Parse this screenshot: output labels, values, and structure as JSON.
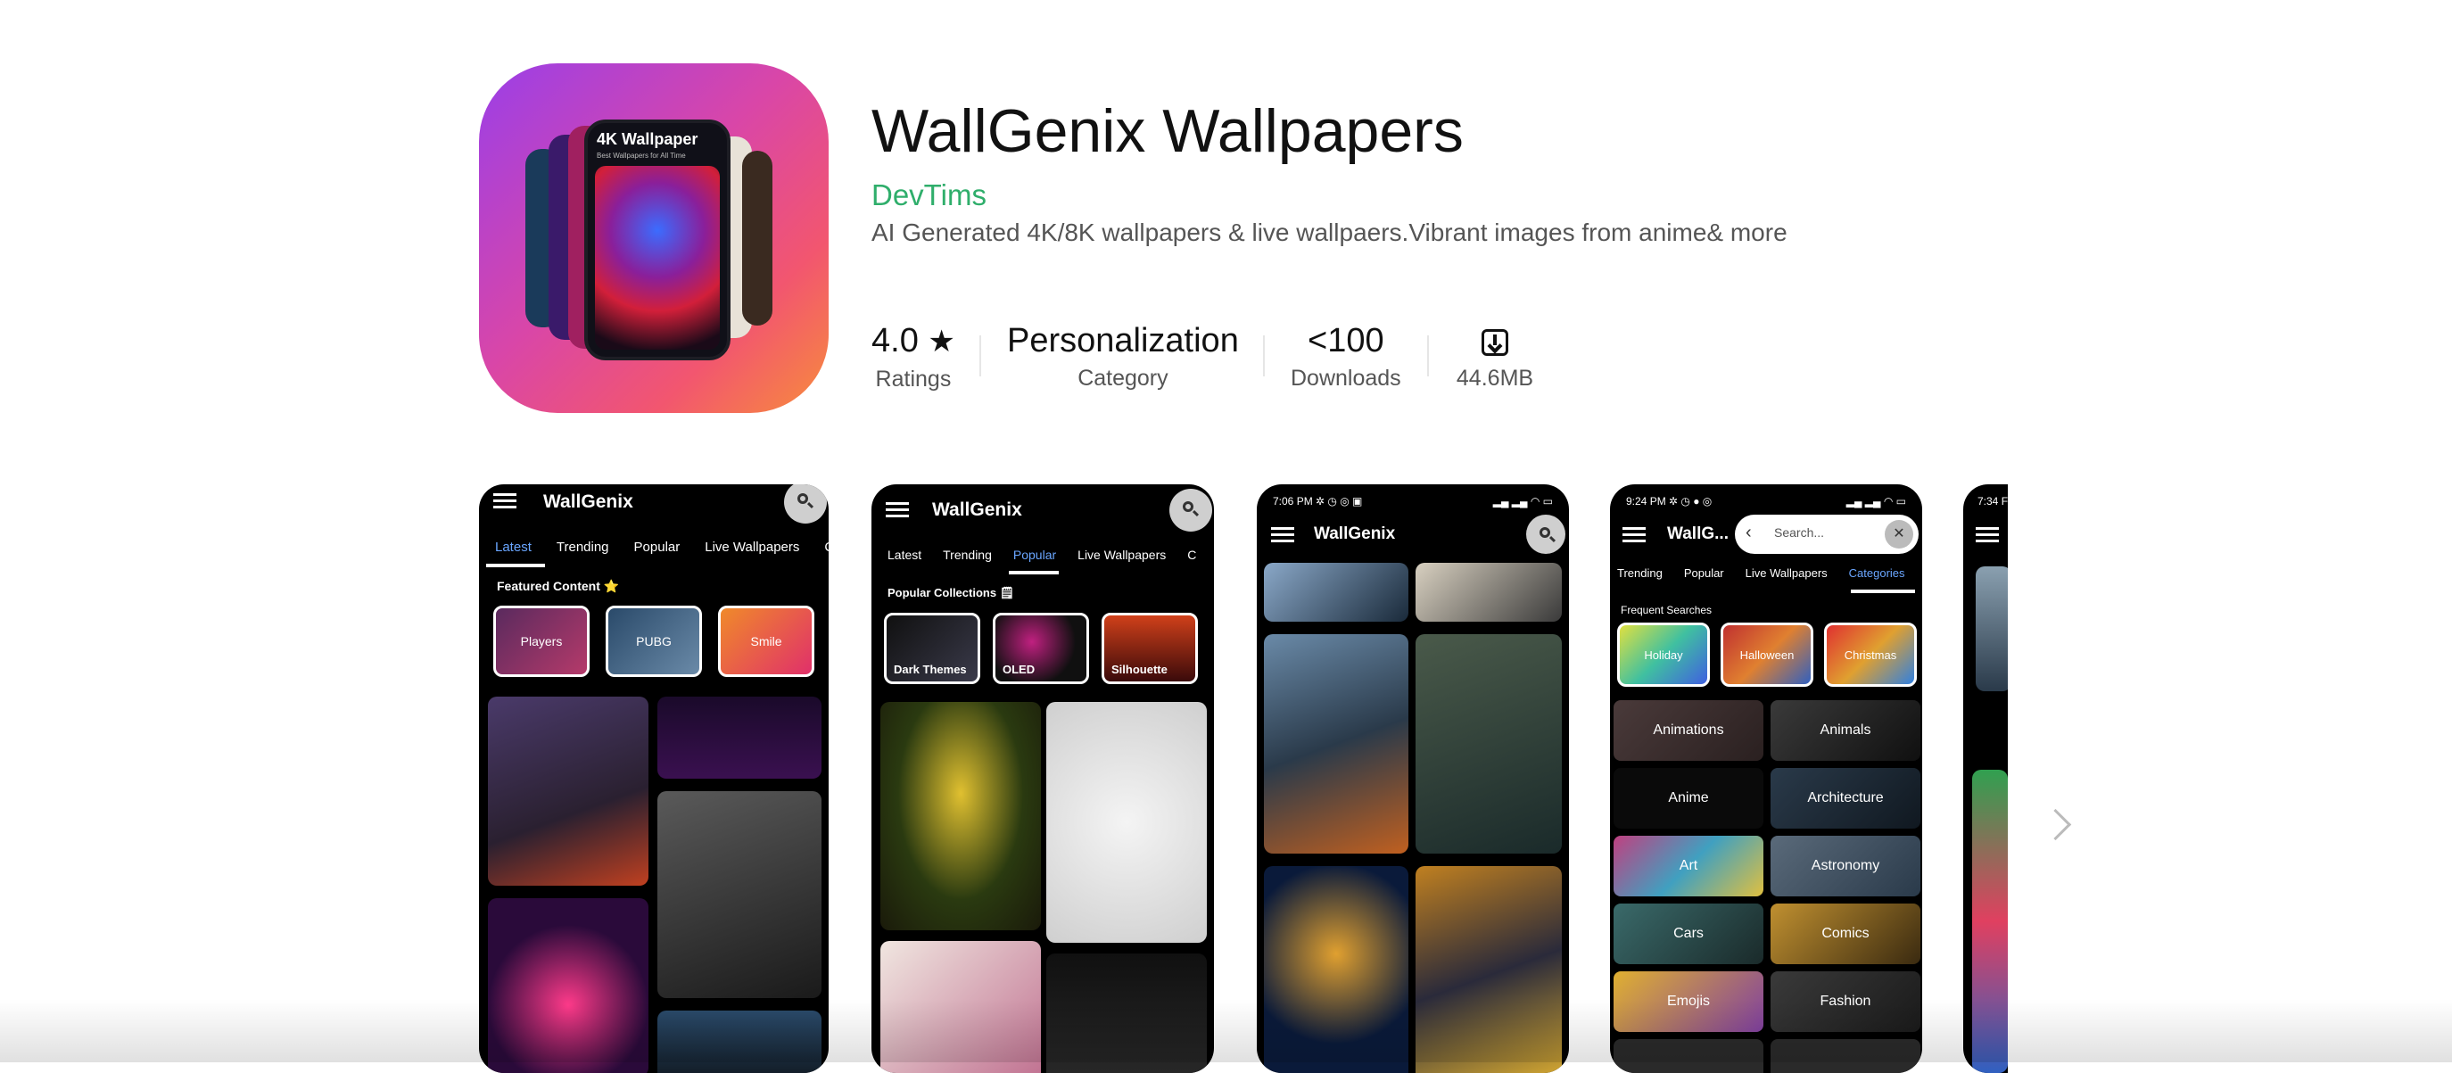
{
  "app": {
    "title": "WallGenix Wallpapers",
    "developer": "DevTims",
    "description": "AI Generated 4K/8K wallpapers & live wallpaers.Vibrant images from anime& more"
  },
  "app_icon": {
    "title": "4K Wallpaper",
    "subtitle": "Best Wallpapers for All Time"
  },
  "stats": {
    "rating_value": "4.0",
    "rating_star": "★",
    "rating_label": "Ratings",
    "category_value": "Personalization",
    "category_label": "Category",
    "downloads_value": "<100",
    "downloads_label": "Downloads",
    "size_value": "44.6MB"
  },
  "screenshots": {
    "s1": {
      "app_name": "WallGenix",
      "tabs": [
        "Latest",
        "Trending",
        "Popular",
        "Live Wallpapers",
        "C"
      ],
      "section": "Featured Content ⭐",
      "chips": [
        "Players",
        "PUBG",
        "Smile"
      ]
    },
    "s2": {
      "app_name": "WallGenix",
      "tabs": [
        "Latest",
        "Trending",
        "Popular",
        "Live Wallpapers",
        "C"
      ],
      "section": "Popular Collections 🗒",
      "chips": [
        "Dark Themes",
        "OLED",
        "Silhouette"
      ]
    },
    "s3": {
      "status_time": "7:06 PM ✲ ◷ ◎ ▣",
      "app_name": "WallGenix"
    },
    "s4": {
      "status_time": "9:24 PM ✲ ◷ ● ◎",
      "app_name": "WallG...",
      "search_placeholder": "Search...",
      "tabs": [
        "Trending",
        "Popular",
        "Live Wallpapers",
        "Categories"
      ],
      "section": "Frequent Searches",
      "chips": [
        "Holiday",
        "Halloween",
        "Christmas"
      ],
      "categories": [
        "Animations",
        "Animals",
        "Anime",
        "Architecture",
        "Art",
        "Astronomy",
        "Cars",
        "Comics",
        "Emojis",
        "Fashion"
      ]
    },
    "s5": {
      "status_time": "7:34 F"
    }
  },
  "colors": {
    "developer": "#2fae6b",
    "active_tab": "#6aa6ff"
  }
}
